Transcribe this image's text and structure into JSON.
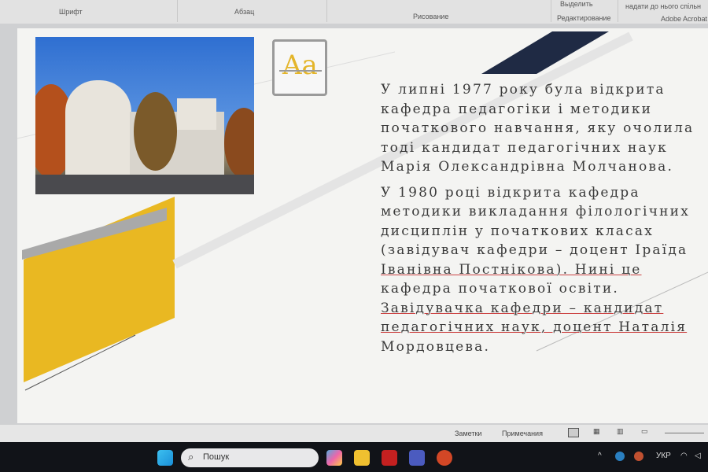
{
  "ribbon": {
    "groups": [
      "Шрифт",
      "Абзац",
      "Рисование",
      "Редактирование",
      "Adobe Acrobat"
    ],
    "select": "Выделить",
    "share": "надати до нього спільн"
  },
  "slide": {
    "paragraphs": [
      {
        "lines": [
          "У липні 1977 року була відкрита",
          "кафедра педагогіки і методики",
          "початкового навчання, яку очолила",
          "тоді кандидат педагогічних наук",
          "Марія Олександрівна Молчанова."
        ]
      },
      {
        "lines": [
          "У 1980 році відкрита кафедра",
          "методики викладання філологічних",
          "дисциплін у початкових класах",
          "(завідувач кафедри – доцент Іраїда",
          "Іванівна Постнікова). Нині це",
          "кафедра початкової освіти.",
          "Завідувачка кафедри – кандидат",
          "педагогічних наук, доцент Наталія",
          "Мордовцева."
        ]
      }
    ],
    "icon_text": "Aa"
  },
  "status": {
    "notes": "Заметки",
    "comments": "Примечания"
  },
  "taskbar": {
    "search_placeholder": "Пошук",
    "language": "УКР"
  },
  "colors": {
    "accent_yellow": "#e9b822",
    "navy": "#1f2a44"
  }
}
